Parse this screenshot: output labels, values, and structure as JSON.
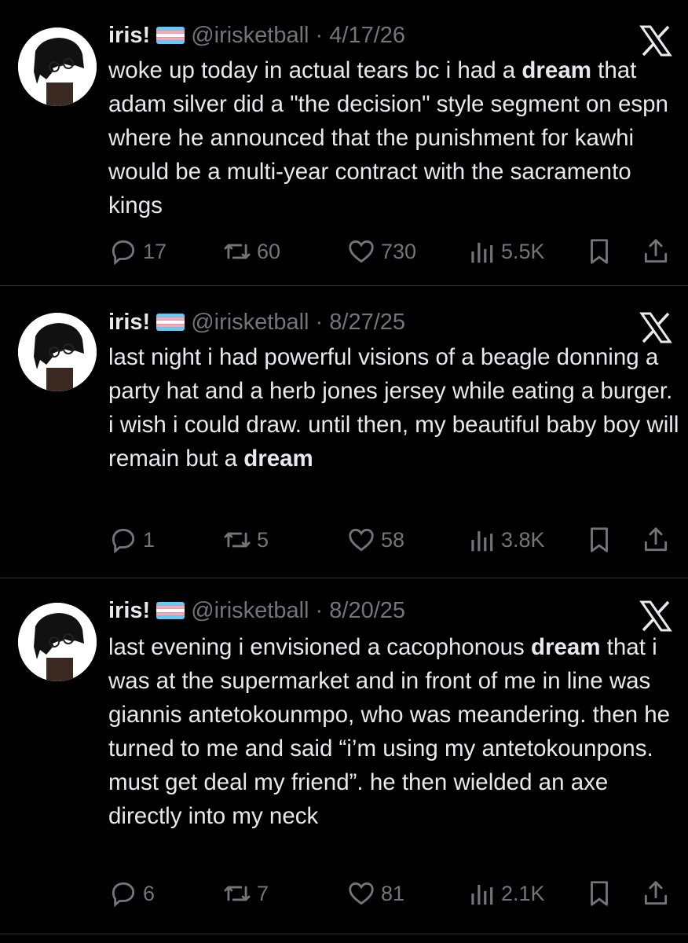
{
  "tweets": [
    {
      "name": "iris!",
      "handle": "@irisketball",
      "date": "4/17/26",
      "text_segments": [
        {
          "t": "woke up today in actual tears bc i had a ",
          "b": false
        },
        {
          "t": "dream",
          "b": true
        },
        {
          "t": " that adam silver did a \"the decision\" style segment on espn where he announced that the punishment for kawhi would be a multi-year contract with the sacramento kings",
          "b": false
        }
      ],
      "replies": "17",
      "retweets": "60",
      "likes": "730",
      "views": "5.5K"
    },
    {
      "name": "iris!",
      "handle": "@irisketball",
      "date": "8/27/25",
      "text_segments": [
        {
          "t": "last night i had powerful visions of a beagle donning a party hat and a herb jones jersey while eating a burger. i wish i could draw. until then, my beautiful baby boy will remain but a ",
          "b": false
        },
        {
          "t": "dream",
          "b": true
        }
      ],
      "replies": "1",
      "retweets": "5",
      "likes": "58",
      "views": "3.8K"
    },
    {
      "name": "iris!",
      "handle": "@irisketball",
      "date": "8/20/25",
      "text_segments": [
        {
          "t": "last evening i envisioned a cacophonous ",
          "b": false
        },
        {
          "t": "dream",
          "b": true
        },
        {
          "t": " that i was at the supermarket and in front of me in line was giannis antetokounmpo, who was meandering. then he turned to me and said “i’m using my antetokounpons. must get deal my friend”. he then wielded an axe directly into my neck",
          "b": false
        }
      ],
      "replies": "6",
      "retweets": "7",
      "likes": "81",
      "views": "2.1K"
    }
  ],
  "icons": {
    "reply": "reply-icon",
    "retweet": "retweet-icon",
    "like": "heart-icon",
    "views": "views-icon",
    "bookmark": "bookmark-icon",
    "share": "share-icon",
    "platform": "x-logo-icon",
    "flag": "trans-flag-icon"
  },
  "colors": {
    "background": "#000000",
    "text": "#e7e9ea",
    "muted": "#71767b",
    "divider": "#2f3336"
  }
}
